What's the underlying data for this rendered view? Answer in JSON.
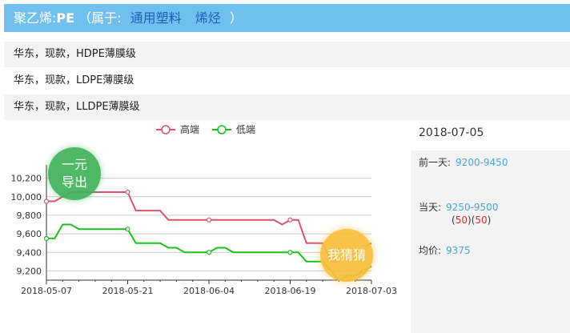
{
  "header": {
    "product": "聚乙烯:",
    "code": "PE",
    "belongs_prefix": "（属于:",
    "categories": [
      "通用塑料",
      "烯烃"
    ],
    "belongs_suffix": "）"
  },
  "rows": [
    {
      "label": "华东，现款，HDPE薄膜级"
    },
    {
      "label": "华东，现款，LDPE薄膜级"
    },
    {
      "label": "华东，现款，LLDPE薄膜级"
    }
  ],
  "buttons": {
    "export_line1": "一元",
    "export_line2": "导出",
    "guess": "我猜猜"
  },
  "panel": {
    "date": "2018-07-05",
    "prev_label": "前一天:",
    "prev_value": "9200-9450",
    "today_label": "当天:",
    "today_value": "9250-9500",
    "change_open": "(",
    "change_low": "50",
    "change_mid": ")(",
    "change_high": "50",
    "change_close": ")",
    "avg_label": "均价:",
    "avg_value": "9375"
  },
  "chart_data": {
    "type": "line",
    "legend_position": "top",
    "grid": true,
    "ylim": [
      9100,
      10300
    ],
    "y_ticks": [
      9200,
      9400,
      9600,
      9800,
      10000,
      10200
    ],
    "y_tick_labels": [
      "9,200",
      "9,400",
      "9,600",
      "9,800",
      "10,000",
      "10,200"
    ],
    "x_tick_labels": [
      "2018-05-07",
      "2018-05-21",
      "2018-06-04",
      "2018-06-19",
      "2018-07-03"
    ],
    "x_tick_index": [
      0,
      10,
      20,
      30,
      40
    ],
    "series": [
      {
        "name": "高端",
        "color": "#d9536a",
        "values": [
          9950,
          9950,
          10000,
          10050,
          10050,
          10050,
          10050,
          10050,
          10050,
          10050,
          10050,
          9850,
          9850,
          9850,
          9850,
          9750,
          9750,
          9750,
          9750,
          9750,
          9750,
          9750,
          9750,
          9750,
          9750,
          9750,
          9750,
          9750,
          9750,
          9700,
          9750,
          9750,
          9500,
          9500,
          9500,
          9300,
          9300,
          9350,
          9400,
          9450,
          9500
        ]
      },
      {
        "name": "低端",
        "color": "#19c319",
        "values": [
          9550,
          9550,
          9700,
          9700,
          9650,
          9650,
          9650,
          9650,
          9650,
          9650,
          9650,
          9500,
          9500,
          9500,
          9500,
          9450,
          9450,
          9400,
          9400,
          9400,
          9400,
          9450,
          9450,
          9400,
          9400,
          9400,
          9400,
          9400,
          9400,
          9400,
          9400,
          9400,
          9300,
          9300,
          9300,
          9200,
          9100,
          9150,
          9150,
          9200,
          9250
        ]
      }
    ],
    "markers": [
      0,
      10,
      20,
      30,
      39
    ]
  }
}
